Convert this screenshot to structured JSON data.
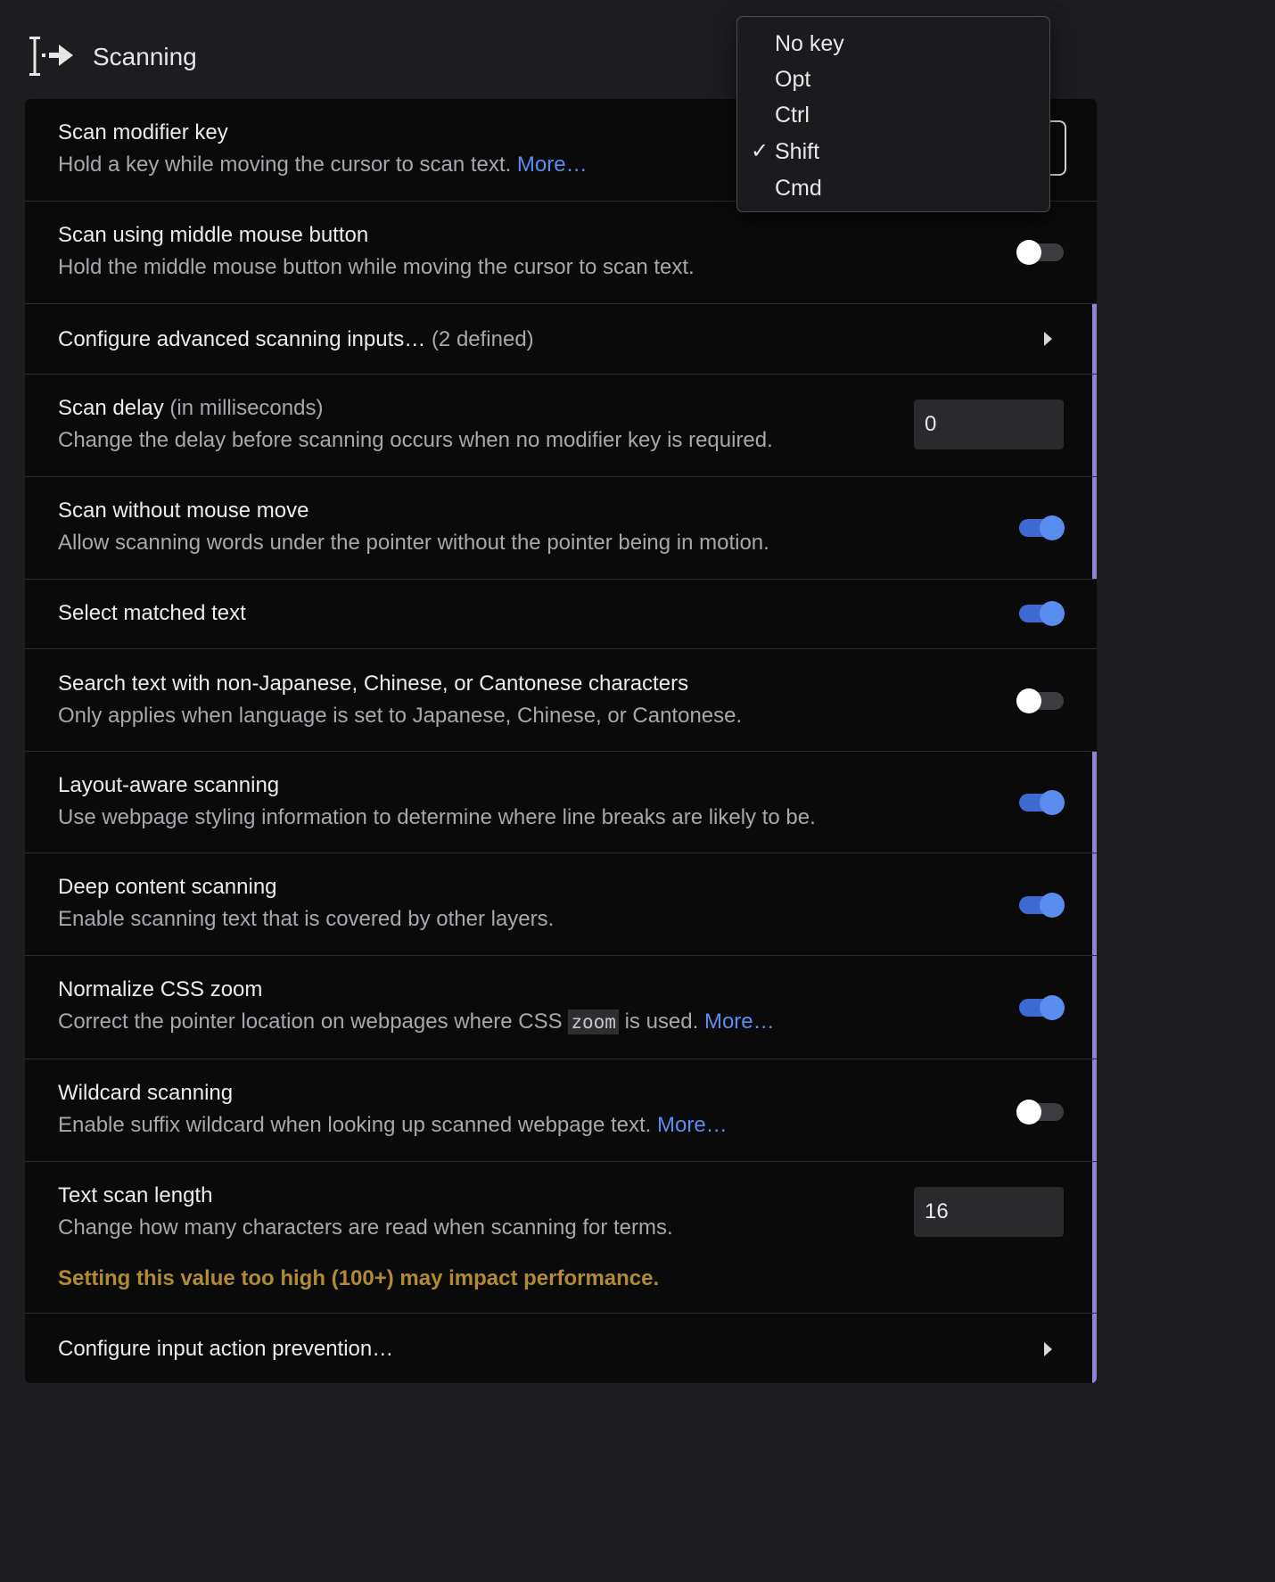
{
  "section": {
    "title": "Scanning",
    "icon": "scan-text-icon"
  },
  "rows": {
    "modifier": {
      "label": "Scan modifier key",
      "desc": "Hold a key while moving the cursor to scan text.",
      "more": "More…"
    },
    "middle_mouse": {
      "label": "Scan using middle mouse button",
      "desc": "Hold the middle mouse button while moving the cursor to scan text.",
      "enabled": false
    },
    "advanced_inputs": {
      "label": "Configure advanced scanning inputs…",
      "note": "(2 defined)"
    },
    "delay": {
      "label": "Scan delay",
      "note": "(in milliseconds)",
      "desc": "Change the delay before scanning occurs when no modifier key is required.",
      "value": "0"
    },
    "no_mouse_move": {
      "label": "Scan without mouse move",
      "desc": "Allow scanning words under the pointer without the pointer being in motion.",
      "enabled": true
    },
    "select_matched": {
      "label": "Select matched text",
      "enabled": true
    },
    "non_cjk": {
      "label": "Search text with non-Japanese, Chinese, or Cantonese characters",
      "desc": "Only applies when language is set to Japanese, Chinese, or Cantonese.",
      "enabled": false
    },
    "layout_aware": {
      "label": "Layout-aware scanning",
      "desc": "Use webpage styling information to determine where line breaks are likely to be.",
      "enabled": true
    },
    "deep_content": {
      "label": "Deep content scanning",
      "desc": "Enable scanning text that is covered by other layers.",
      "enabled": true
    },
    "css_zoom": {
      "label": "Normalize CSS zoom",
      "desc_before": "Correct the pointer location on webpages where CSS",
      "code": "zoom",
      "desc_after": "is used.",
      "more": "More…",
      "enabled": true
    },
    "wildcard": {
      "label": "Wildcard scanning",
      "desc": "Enable suffix wildcard when looking up scanned webpage text.",
      "more": "More…",
      "enabled": false
    },
    "scan_length": {
      "label": "Text scan length",
      "desc": "Change how many characters are read when scanning for terms.",
      "warning": "Setting this value too high (100+) may impact performance.",
      "value": "16"
    },
    "input_prevention": {
      "label": "Configure input action prevention…"
    }
  },
  "modifier_menu": {
    "options": [
      "No key",
      "Opt",
      "Ctrl",
      "Shift",
      "Cmd"
    ],
    "selected": "Shift",
    "check_glyph": "✓"
  },
  "colors": {
    "accent": "#5b8def",
    "advanced_marker": "#8d84d6",
    "warning": "#b08a34",
    "background": "#1d1d1f",
    "panel": "#0a0a0b"
  }
}
